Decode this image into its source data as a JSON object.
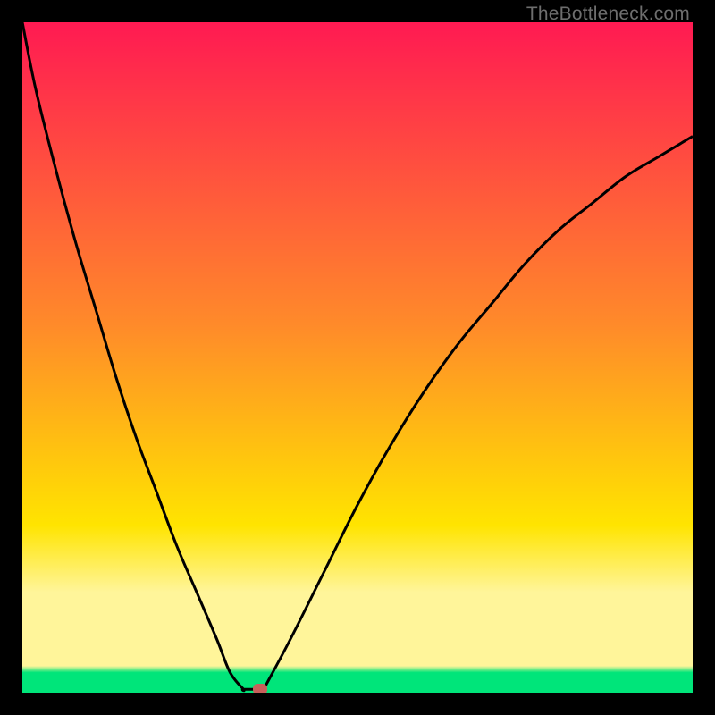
{
  "watermark": "TheBottleneck.com",
  "colors": {
    "top": "#ff1a52",
    "mid1": "#ff8a2a",
    "mid2": "#ffe400",
    "band": "#fff59a",
    "base": "#00e57a",
    "curve": "#000000",
    "dot": "#c75f5a",
    "frame": "#000000"
  },
  "chart_data": {
    "type": "line",
    "title": "",
    "xlabel": "",
    "ylabel": "",
    "xlim": [
      0,
      100
    ],
    "ylim": [
      0,
      100
    ],
    "notes": "Bottleneck-style V curve over red→yellow→green vertical gradient. Minimum (optimal point) near x≈34 at y≈0. Axes and ticks are hidden; background color encodes desirability (green=good, red=bad).",
    "series": [
      {
        "name": "left-branch",
        "x": [
          0,
          2,
          5,
          8,
          11,
          14,
          17,
          20,
          23,
          26,
          29,
          31,
          33
        ],
        "y": [
          100,
          90,
          78,
          67,
          57,
          47,
          38,
          30,
          22,
          15,
          8,
          3,
          0.5
        ]
      },
      {
        "name": "flat-min",
        "x": [
          33,
          36
        ],
        "y": [
          0.5,
          0.5
        ]
      },
      {
        "name": "right-branch",
        "x": [
          36,
          40,
          45,
          50,
          55,
          60,
          65,
          70,
          75,
          80,
          85,
          90,
          95,
          100
        ],
        "y": [
          0.5,
          8,
          18,
          28,
          37,
          45,
          52,
          58,
          64,
          69,
          73,
          77,
          80,
          83
        ]
      }
    ],
    "marker": {
      "x": 35.5,
      "y": 0.5,
      "name": "optimal-point"
    },
    "gradient_bands_y_pct_from_top": {
      "red_to_orange": 45,
      "orange_to_yellow": 75,
      "pale_band_start": 85,
      "pale_band_end": 96,
      "green_start": 96
    }
  }
}
